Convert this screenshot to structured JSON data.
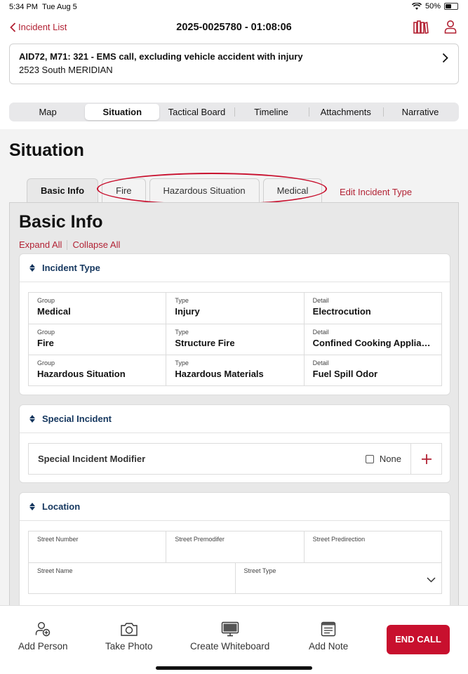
{
  "status_bar": {
    "time": "5:34 PM",
    "date": "Tue Aug 5",
    "battery": "50%",
    "battery_level": 0.5
  },
  "nav": {
    "back_label": "Incident List",
    "title": "2025-0025780 - 01:08:06"
  },
  "incident": {
    "summary": "AID72, M71: 321 - EMS call, excluding vehicle accident with injury",
    "address": "2523 South MERIDIAN"
  },
  "segments": [
    {
      "label": "Map"
    },
    {
      "label": "Situation",
      "active": true
    },
    {
      "label": "Tactical Board"
    },
    {
      "label": "Timeline"
    },
    {
      "label": "Attachments"
    },
    {
      "label": "Narrative"
    }
  ],
  "page": {
    "title": "Situation"
  },
  "tabs": [
    {
      "label": "Basic Info",
      "active": true
    },
    {
      "label": "Fire"
    },
    {
      "label": "Hazardous Situation"
    },
    {
      "label": "Medical"
    }
  ],
  "edit_incident_type": "Edit Incident Type",
  "panel": {
    "title": "Basic Info",
    "expand_all": "Expand All",
    "collapse_all": "Collapse All"
  },
  "incident_type": {
    "header": "Incident Type",
    "rows": [
      {
        "group_label": "Group",
        "group": "Medical",
        "type_label": "Type",
        "type": "Injury",
        "detail_label": "Detail",
        "detail": "Electrocution"
      },
      {
        "group_label": "Group",
        "group": "Fire",
        "type_label": "Type",
        "type": "Structure Fire",
        "detail_label": "Detail",
        "detail": "Confined Cooking Applian..."
      },
      {
        "group_label": "Group",
        "group": "Hazardous Situation",
        "type_label": "Type",
        "type": "Hazardous Materials",
        "detail_label": "Detail",
        "detail": "Fuel Spill Odor"
      }
    ]
  },
  "special_incident": {
    "header": "Special Incident",
    "modifier_label": "Special Incident Modifier",
    "none_label": "None",
    "none_checked": false
  },
  "location": {
    "header": "Location",
    "street_number": "Street Number",
    "street_premodifier": "Street Premodifer",
    "street_predirection": "Street Predirection",
    "street_name": "Street Name",
    "street_type": "Street Type"
  },
  "actions": {
    "add_person": "Add Person",
    "take_photo": "Take Photo",
    "create_whiteboard": "Create Whiteboard",
    "add_note": "Add Note",
    "end_call": "END CALL"
  },
  "colors": {
    "accent": "#c8102e",
    "link": "#b22234",
    "section_header": "#14365e"
  }
}
